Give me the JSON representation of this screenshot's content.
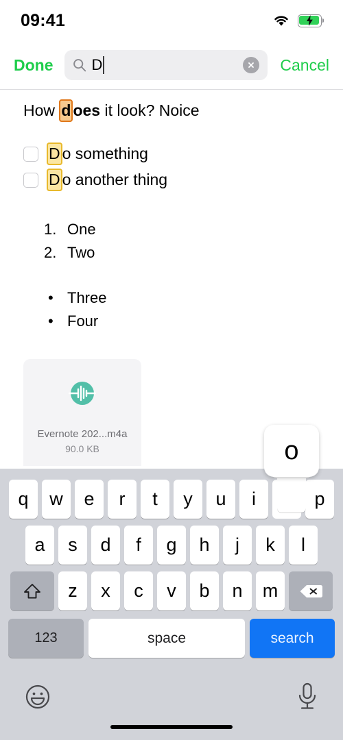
{
  "status_bar": {
    "time": "09:41",
    "wifi_icon": "wifi-icon",
    "battery_icon": "battery-charging-icon",
    "battery_color": "#31d158"
  },
  "search_header": {
    "done_label": "Done",
    "cancel_label": "Cancel",
    "search_icon": "search-icon",
    "clear_icon": "clear-circle-icon",
    "query_value": "D",
    "accent_color": "#1ecd4b",
    "field_background": "#eeeef0"
  },
  "note": {
    "paragraph": {
      "prefix": "How ",
      "match": "d",
      "bold_rest": "oes",
      "suffix": " it look? Noice",
      "highlight_active_bg": "#f6c98e",
      "highlight_active_border": "#e0781b"
    },
    "todos": [
      {
        "match": "D",
        "rest": "o something",
        "checked": false
      },
      {
        "match": "D",
        "rest": "o another thing",
        "checked": false
      }
    ],
    "highlight_other_bg": "#fbe6a2",
    "highlight_other_border": "#e8b92c",
    "numbered_list": [
      {
        "marker": "1.",
        "text": "One"
      },
      {
        "marker": "2.",
        "text": "Two"
      }
    ],
    "bulleted_list": [
      {
        "marker": "•",
        "text": "Three"
      },
      {
        "marker": "•",
        "text": "Four"
      }
    ],
    "attachment": {
      "icon": "audio-waveform-icon",
      "icon_color": "#52bfa8",
      "filename": "Evernote 202...m4a",
      "filesize": "90.0 KB"
    }
  },
  "keyboard": {
    "popup_letter": "o",
    "row1": [
      "q",
      "w",
      "e",
      "r",
      "t",
      "y",
      "u",
      "i",
      "o",
      "p"
    ],
    "row2": [
      "a",
      "s",
      "d",
      "f",
      "g",
      "h",
      "j",
      "k",
      "l"
    ],
    "row3": [
      "z",
      "x",
      "c",
      "v",
      "b",
      "n",
      "m"
    ],
    "shift_icon": "shift-arrow-icon",
    "backspace_icon": "backspace-icon",
    "numbers_label": "123",
    "space_label": "space",
    "return_label": "search",
    "return_color": "#1175f5",
    "emoji_icon": "emoji-smiley-icon",
    "mic_icon": "microphone-icon",
    "background": "#d1d3d9"
  }
}
